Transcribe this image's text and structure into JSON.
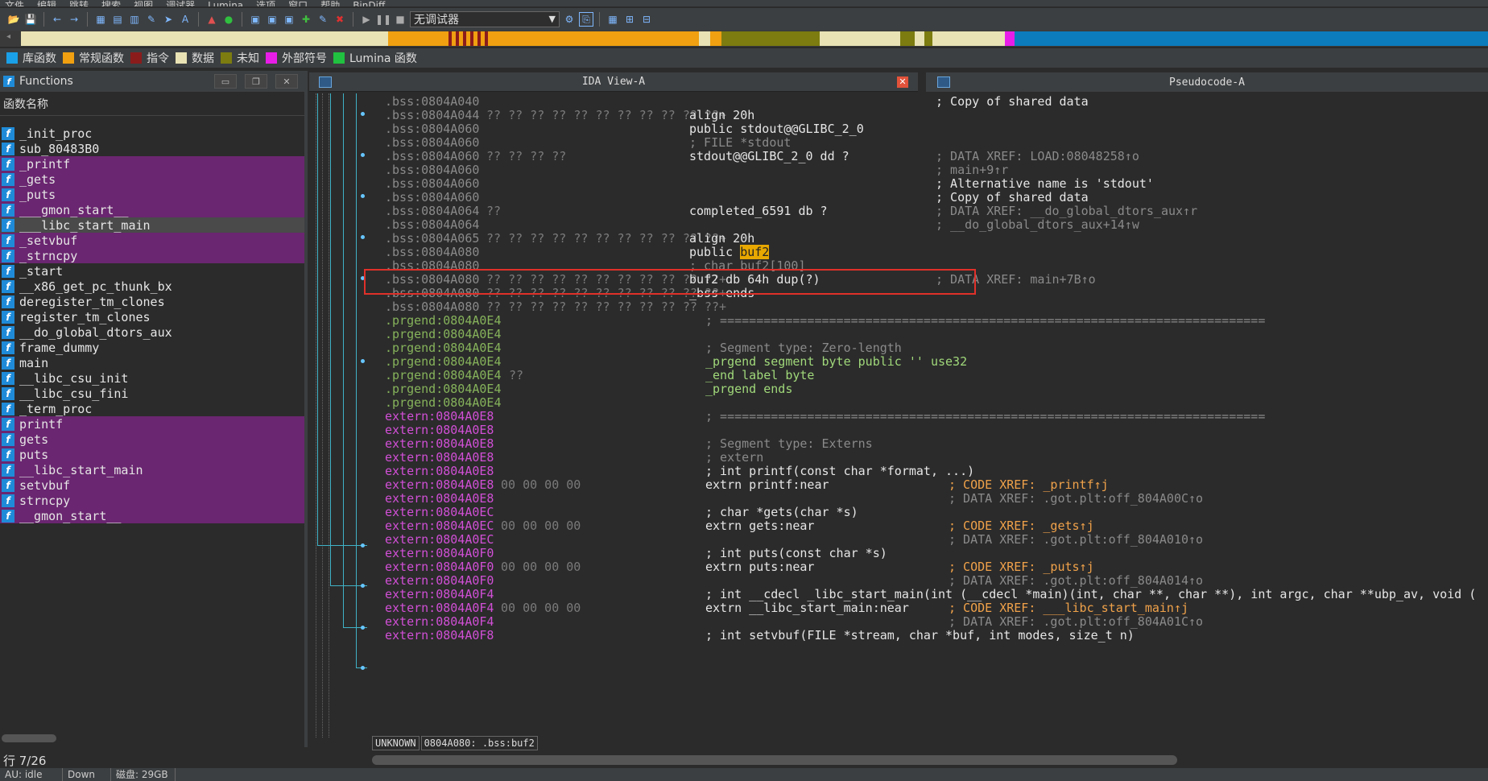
{
  "menu": [
    "文件",
    "编辑",
    "跳转",
    "搜索",
    "视图",
    "调试器",
    "Lumina",
    "选项",
    "窗口",
    "帮助",
    "BinDiff"
  ],
  "toolbar": {
    "debugger_label": "无调试器"
  },
  "colors": {
    "library": "#1aa0e8",
    "regular": "#f0a010",
    "instruction": "#8b1c1c",
    "data": "#e8e2b4",
    "unexplored": "#7c7c10",
    "external": "#e81ee8",
    "lumina": "#20c040"
  },
  "legend": [
    {
      "label": "库函数",
      "color": "#1aa0e8"
    },
    {
      "label": "常规函数",
      "color": "#f0a010"
    },
    {
      "label": "指令",
      "color": "#8b1c1c"
    },
    {
      "label": "数据",
      "color": "#e8e2b4"
    },
    {
      "label": "未知",
      "color": "#7c7c10"
    },
    {
      "label": "外部符号",
      "color": "#e81ee8"
    },
    {
      "label": "Lumina 函数",
      "color": "#20c040"
    }
  ],
  "functions_panel": {
    "title": "Functions",
    "column_header": "函数名称",
    "items": [
      {
        "name": "_init_proc",
        "kind": "normal"
      },
      {
        "name": "sub_80483B0",
        "kind": "normal"
      },
      {
        "name": "_printf",
        "kind": "lib"
      },
      {
        "name": "_gets",
        "kind": "lib"
      },
      {
        "name": "_puts",
        "kind": "lib"
      },
      {
        "name": "___gmon_start__",
        "kind": "lib"
      },
      {
        "name": "___libc_start_main",
        "kind": "libsel"
      },
      {
        "name": "_setvbuf",
        "kind": "lib"
      },
      {
        "name": "_strncpy",
        "kind": "lib"
      },
      {
        "name": "_start",
        "kind": "normal"
      },
      {
        "name": "__x86_get_pc_thunk_bx",
        "kind": "normal"
      },
      {
        "name": "deregister_tm_clones",
        "kind": "normal"
      },
      {
        "name": "register_tm_clones",
        "kind": "normal"
      },
      {
        "name": "__do_global_dtors_aux",
        "kind": "normal"
      },
      {
        "name": "frame_dummy",
        "kind": "normal"
      },
      {
        "name": "main",
        "kind": "normal"
      },
      {
        "name": "__libc_csu_init",
        "kind": "normal"
      },
      {
        "name": "__libc_csu_fini",
        "kind": "normal"
      },
      {
        "name": "_term_proc",
        "kind": "normal"
      },
      {
        "name": "printf",
        "kind": "lib"
      },
      {
        "name": "gets",
        "kind": "lib"
      },
      {
        "name": "puts",
        "kind": "lib"
      },
      {
        "name": "__libc_start_main",
        "kind": "lib"
      },
      {
        "name": "setvbuf",
        "kind": "lib"
      },
      {
        "name": "strncpy",
        "kind": "lib"
      },
      {
        "name": "__gmon_start__",
        "kind": "lib"
      }
    ],
    "row_info": "行 7/26"
  },
  "status_bar": [
    "AU:  idle",
    "Down",
    "磁盘: 29GB"
  ],
  "tabs": {
    "ida_view": "IDA View-A",
    "pseudocode": "Pseudocode-A"
  },
  "code_status": {
    "mode": "UNKNOWN",
    "location": "0804A080: .bss:buf2"
  },
  "disasm": [
    {
      "addr": ".bss:0804A040",
      "cls": "bss",
      "bytes": "",
      "instr": "",
      "ix": 0,
      "cmt": "; Copy of shared data",
      "cx": 0
    },
    {
      "addr": ".bss:0804A044",
      "cls": "bss",
      "bytes": "?? ?? ?? ?? ?? ?? ?? ?? ?? ?? ??+",
      "instr": "align 20h",
      "ix": 0,
      "cmt": "",
      "cx": 0
    },
    {
      "addr": ".bss:0804A060",
      "cls": "bss",
      "bytes": "",
      "instr": "public stdout@@GLIBC_2_0",
      "ix": 0,
      "cmt": "",
      "cx": 0
    },
    {
      "addr": ".bss:0804A060",
      "cls": "bss",
      "bytes": "",
      "instr": "; FILE *stdout",
      "ix": 0,
      "cmt": "",
      "cx": 0
    },
    {
      "addr": ".bss:0804A060",
      "cls": "bss",
      "bytes": "?? ?? ?? ??",
      "instr": "stdout@@GLIBC_2_0 dd ?",
      "ix": 0,
      "cmt": "; DATA XREF: LOAD:08048258↑o",
      "cx": 0
    },
    {
      "addr": ".bss:0804A060",
      "cls": "bss",
      "bytes": "",
      "instr": "",
      "ix": 0,
      "cmt": "; main+9↑r",
      "cx": 0
    },
    {
      "addr": ".bss:0804A060",
      "cls": "bss",
      "bytes": "",
      "instr": "",
      "ix": 0,
      "cmt": "; Alternative name is 'stdout'",
      "cx": 0
    },
    {
      "addr": ".bss:0804A060",
      "cls": "bss",
      "bytes": "",
      "instr": "",
      "ix": 0,
      "cmt": "; Copy of shared data",
      "cx": 0
    },
    {
      "addr": ".bss:0804A064",
      "cls": "bss",
      "bytes": "??",
      "instr": "completed_6591 db ?",
      "ix": 0,
      "cmt": "; DATA XREF: __do_global_dtors_aux↑r",
      "cx": 0
    },
    {
      "addr": ".bss:0804A064",
      "cls": "bss",
      "bytes": "",
      "instr": "",
      "ix": 0,
      "cmt": "; __do_global_dtors_aux+14↑w",
      "cx": 0
    },
    {
      "addr": ".bss:0804A065",
      "cls": "bss",
      "bytes": "?? ?? ?? ?? ?? ?? ?? ?? ?? ?? ??+",
      "instr": "align 20h",
      "ix": 0,
      "cmt": "",
      "cx": 0
    },
    {
      "addr": ".bss:0804A080",
      "cls": "bss",
      "bytes": "",
      "instr": "public buf2",
      "ix": 0,
      "cmt": "",
      "cx": 0
    },
    {
      "addr": ".bss:0804A080",
      "cls": "bss",
      "bytes": "",
      "instr": "; char buf2[100]",
      "ix": 0,
      "cmt": "",
      "cx": 0
    },
    {
      "addr": ".bss:0804A080",
      "cls": "bss",
      "bytes": "?? ?? ?? ?? ?? ?? ?? ?? ?? ?? ??+",
      "instr": "buf2 db 64h dup(?)",
      "ix": 0,
      "cmt": "; DATA XREF: main+7B↑o",
      "cx": 0
    },
    {
      "addr": ".bss:0804A080",
      "cls": "bss",
      "bytes": "?? ?? ?? ?? ?? ?? ?? ?? ?? ?? ??+",
      "instr": "_bss ends",
      "ix": 0,
      "cmt": "",
      "cx": 0
    },
    {
      "addr": ".bss:0804A080",
      "cls": "bss",
      "bytes": "?? ?? ?? ?? ?? ?? ?? ?? ?? ?? ??+",
      "instr": "",
      "ix": 0,
      "cmt": "",
      "cx": 0
    },
    {
      "addr": ".prgend:0804A0E4",
      "cls": "prg",
      "bytes": "",
      "instr": "; ===========================================================================",
      "ix": 1,
      "cmt": "",
      "cx": 0
    },
    {
      "addr": ".prgend:0804A0E4",
      "cls": "prg",
      "bytes": "",
      "instr": "",
      "ix": 1,
      "cmt": "",
      "cx": 0
    },
    {
      "addr": ".prgend:0804A0E4",
      "cls": "prg",
      "bytes": "",
      "instr": "; Segment type: Zero-length",
      "ix": 1,
      "cmt": "",
      "cx": 0
    },
    {
      "addr": ".prgend:0804A0E4",
      "cls": "prg",
      "bytes": "",
      "instr": "_prgend segment byte public '' use32",
      "ix": 1,
      "cmt": "",
      "cx": 0
    },
    {
      "addr": ".prgend:0804A0E4",
      "cls": "prg",
      "bytes": "??",
      "instr": "_end label byte",
      "ix": 1,
      "cmt": "",
      "cx": 0
    },
    {
      "addr": ".prgend:0804A0E4",
      "cls": "prg",
      "bytes": "",
      "instr": "_prgend ends",
      "ix": 1,
      "cmt": "",
      "cx": 0
    },
    {
      "addr": ".prgend:0804A0E4",
      "cls": "prg",
      "bytes": "",
      "instr": "",
      "ix": 1,
      "cmt": "",
      "cx": 0
    },
    {
      "addr": "extern:0804A0E8",
      "cls": "ext",
      "bytes": "",
      "instr": "; ===========================================================================",
      "ix": 2,
      "cmt": "",
      "cx": 0
    },
    {
      "addr": "extern:0804A0E8",
      "cls": "ext",
      "bytes": "",
      "instr": "",
      "ix": 2,
      "cmt": "",
      "cx": 0
    },
    {
      "addr": "extern:0804A0E8",
      "cls": "ext",
      "bytes": "",
      "instr": "; Segment type: Externs",
      "ix": 2,
      "cmt": "",
      "cx": 0
    },
    {
      "addr": "extern:0804A0E8",
      "cls": "ext",
      "bytes": "",
      "instr": "; extern",
      "ix": 2,
      "cmt": "",
      "cx": 0
    },
    {
      "addr": "extern:0804A0E8",
      "cls": "ext",
      "bytes": "",
      "instr": "; int printf(const char *format, ...)",
      "ix": 2,
      "cmt": "",
      "cx": 0
    },
    {
      "addr": "extern:0804A0E8",
      "cls": "ext",
      "bytes": "00 00 00 00",
      "instr": "extrn printf:near",
      "ix": 2,
      "cmt": "; CODE XREF: _printf↑j",
      "cx": 1
    },
    {
      "addr": "extern:0804A0E8",
      "cls": "ext",
      "bytes": "",
      "instr": "",
      "ix": 2,
      "cmt": "; DATA XREF: .got.plt:off_804A00C↑o",
      "cx": 1
    },
    {
      "addr": "extern:0804A0EC",
      "cls": "ext",
      "bytes": "",
      "instr": "; char *gets(char *s)",
      "ix": 2,
      "cmt": "",
      "cx": 1
    },
    {
      "addr": "extern:0804A0EC",
      "cls": "ext",
      "bytes": "00 00 00 00",
      "instr": "extrn gets:near",
      "ix": 2,
      "cmt": "; CODE XREF: _gets↑j",
      "cx": 1
    },
    {
      "addr": "extern:0804A0EC",
      "cls": "ext",
      "bytes": "",
      "instr": "",
      "ix": 2,
      "cmt": "; DATA XREF: .got.plt:off_804A010↑o",
      "cx": 1
    },
    {
      "addr": "extern:0804A0F0",
      "cls": "ext",
      "bytes": "",
      "instr": "; int puts(const char *s)",
      "ix": 2,
      "cmt": "",
      "cx": 1
    },
    {
      "addr": "extern:0804A0F0",
      "cls": "ext",
      "bytes": "00 00 00 00",
      "instr": "extrn puts:near",
      "ix": 2,
      "cmt": "; CODE XREF: _puts↑j",
      "cx": 1
    },
    {
      "addr": "extern:0804A0F0",
      "cls": "ext",
      "bytes": "",
      "instr": "",
      "ix": 2,
      "cmt": "; DATA XREF: .got.plt:off_804A014↑o",
      "cx": 1
    },
    {
      "addr": "extern:0804A0F4",
      "cls": "ext",
      "bytes": "",
      "instr": "; int __cdecl _libc_start_main(int (__cdecl *main)(int, char **, char **), int argc, char **ubp_av, void (",
      "ix": 2,
      "cmt": "",
      "cx": 1
    },
    {
      "addr": "extern:0804A0F4",
      "cls": "ext",
      "bytes": "00 00 00 00",
      "instr": "extrn __libc_start_main:near",
      "ix": 2,
      "cmt": "; CODE XREF: ___libc_start_main↑j",
      "cx": 1
    },
    {
      "addr": "extern:0804A0F4",
      "cls": "ext",
      "bytes": "",
      "instr": "",
      "ix": 2,
      "cmt": "; DATA XREF: .got.plt:off_804A01C↑o",
      "cx": 1
    },
    {
      "addr": "extern:0804A0F8",
      "cls": "ext",
      "bytes": "",
      "instr": "; int setvbuf(FILE *stream, char *buf, int modes, size_t n)",
      "ix": 2,
      "cmt": "",
      "cx": 1
    }
  ]
}
